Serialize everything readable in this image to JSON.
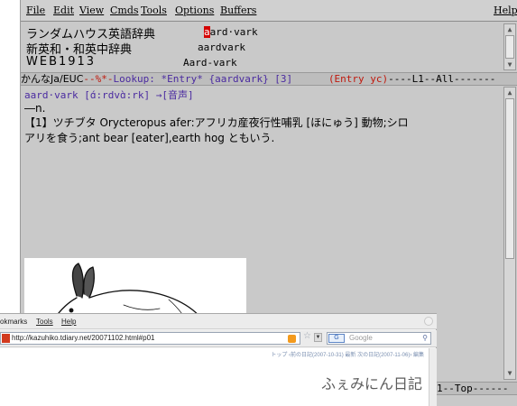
{
  "menubar": {
    "items": [
      "File",
      "Edit",
      "View",
      "Cmds",
      "Tools",
      "Options",
      "Buffers"
    ],
    "help": "Help"
  },
  "dict_list": [
    {
      "name": "ランダムハウス英語辞典",
      "word_cursor": "a",
      "word_rest": "ard·vark"
    },
    {
      "name": "新英和・和英中辞典",
      "word": "aardvark"
    },
    {
      "name": "WEB1913",
      "word": "Aard-vark"
    }
  ],
  "modeline_top": {
    "part1": "かんなJa/EUC",
    "part2": "--%*-",
    "part3": "Lookup: *Entry* {aardvark} [3]",
    "part4": "      ",
    "part5": "(Entry yc)",
    "part6": "----L1--All-------"
  },
  "entry": {
    "headword": "aard·vark [ɑ́:rdvɑ̀:rk] →[音声]",
    "pos": "―n.",
    "definition_1": "【1】ツチブタ Orycteropus afer:アフリカ産夜行性哺乳 [ほにゅう] 動物;シロ",
    "definition_2": "アリを食う;ant bear [eater],earth hog ともいう."
  },
  "corner_modeline": "1--Top------",
  "browser": {
    "menu": {
      "bookmarks": "okmarks",
      "tools": "Tools",
      "help": "Help"
    },
    "url": "http://kazuhiko.tdiary.net/20071102.html#p01",
    "search_placeholder": "Google",
    "search_engine": "G",
    "topnav": "トップ ‹前の日記(2007-10-31) 最新 次の日記(2007-11-06)› 編集",
    "diary_title": "ふぇみにん日記"
  },
  "colors": {
    "emacs_bg": "#c9c9c9",
    "modeline_bg": "#bdbdbd",
    "headword": "#4a2aa0",
    "cursor": "#d40000",
    "modeline_red": "#c0180c"
  },
  "icons": {
    "scroll_up": "triangle-up",
    "scroll_down": "triangle-down",
    "rss": "rss-icon",
    "star": "star-icon",
    "search_go": "magnifier-icon"
  }
}
